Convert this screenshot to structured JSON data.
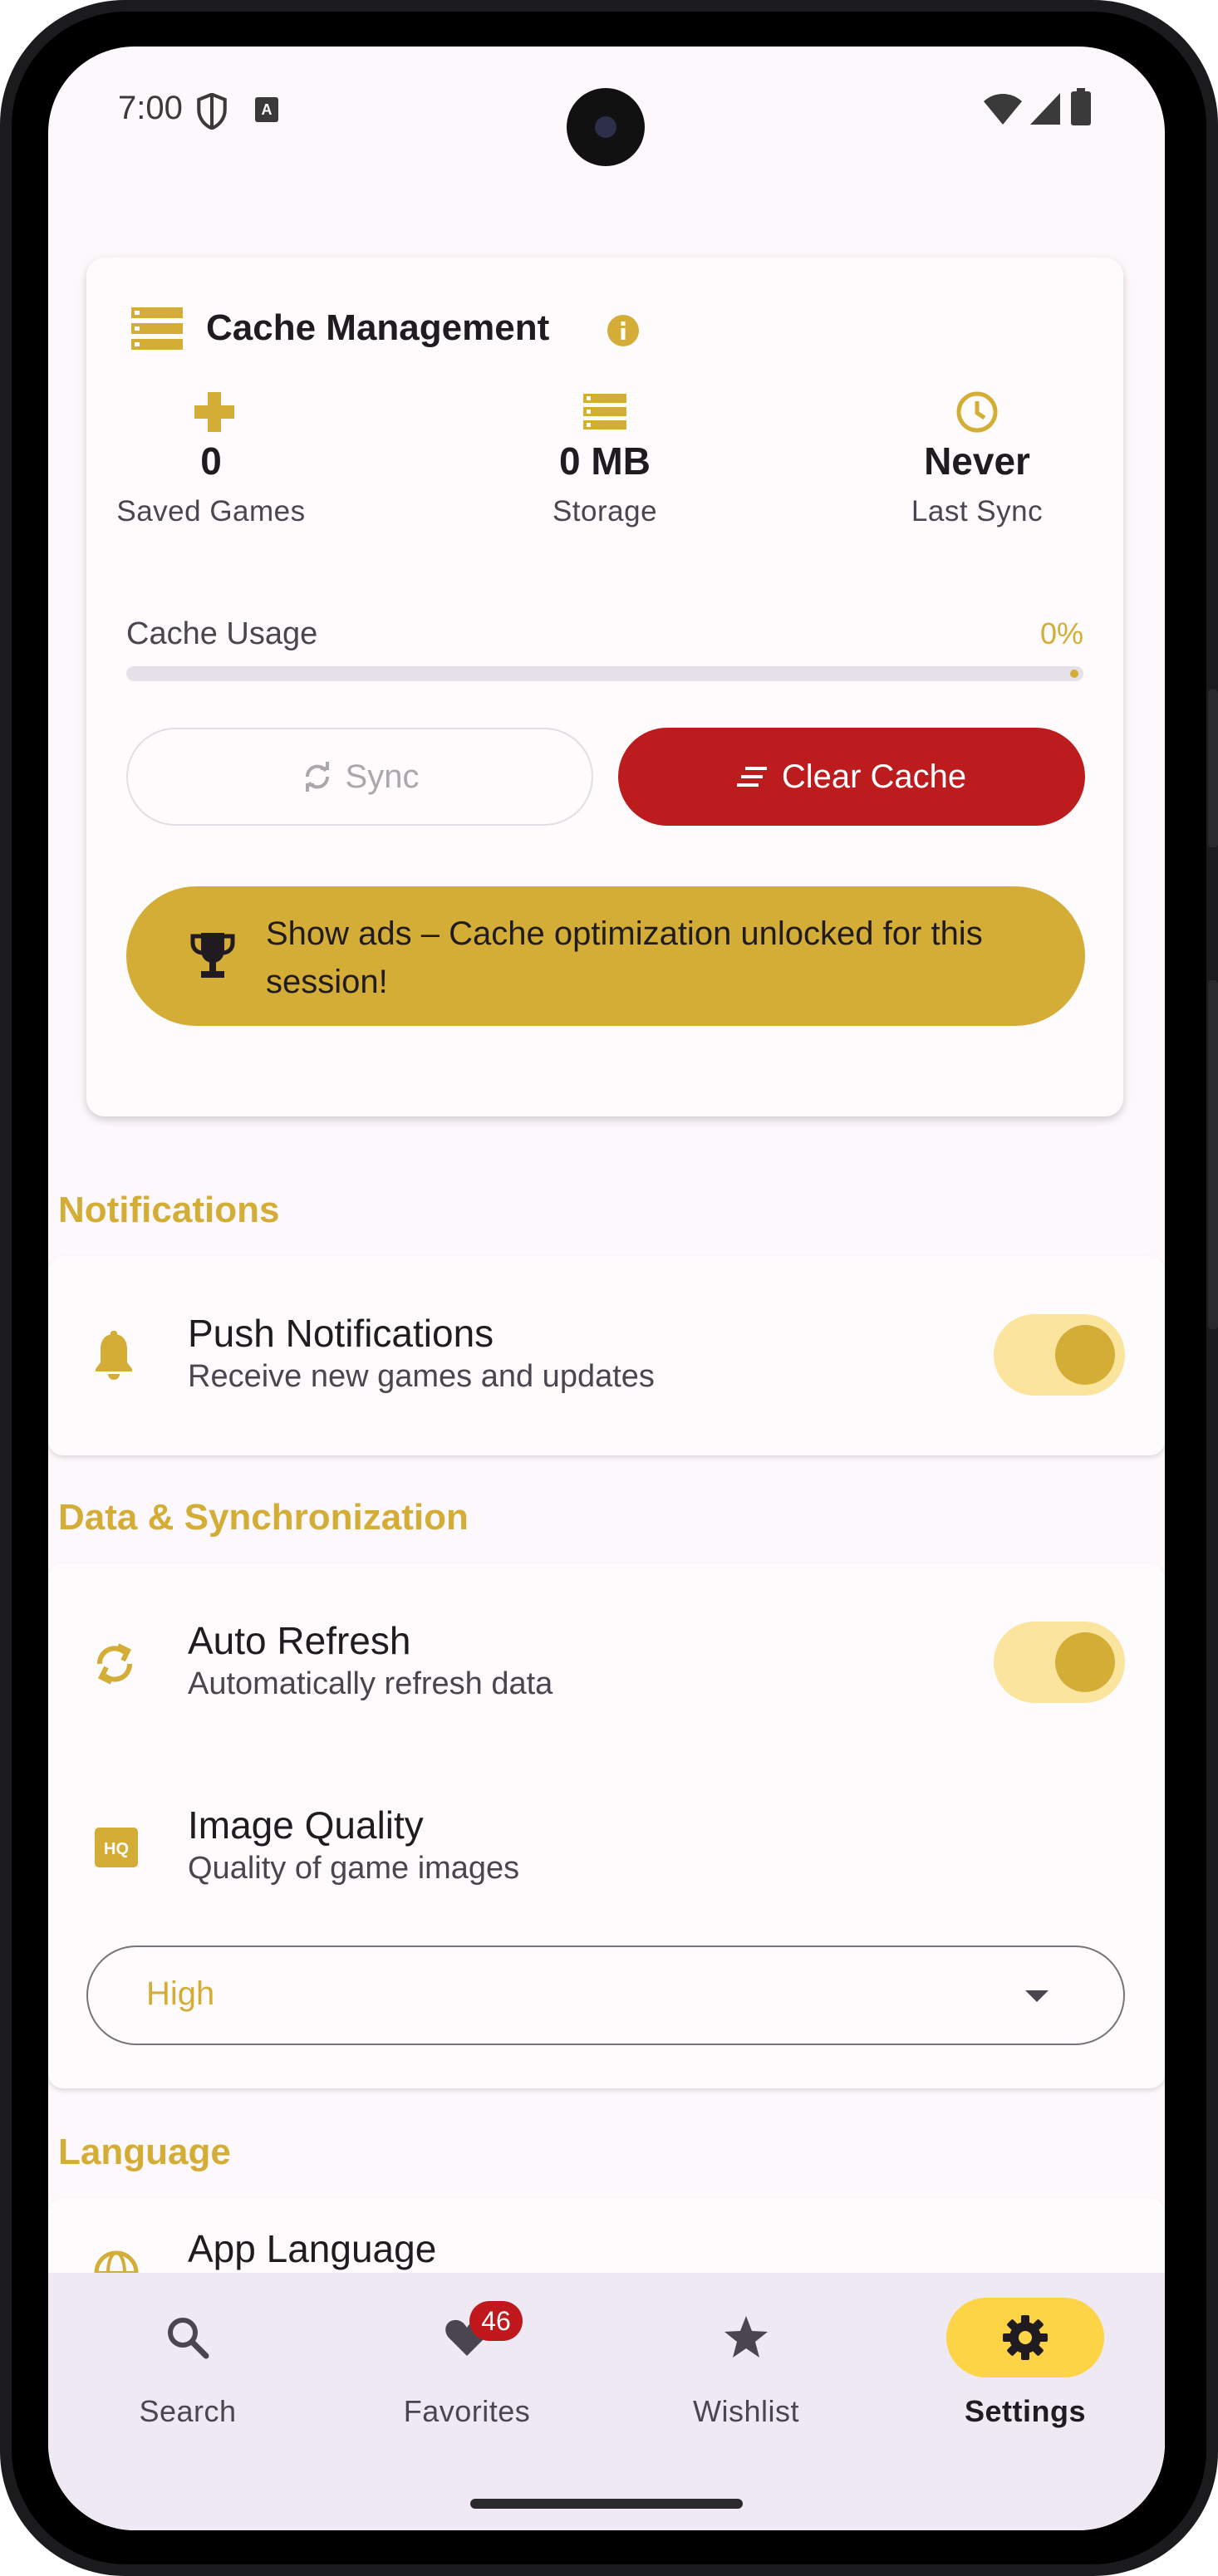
{
  "status_bar": {
    "time": "7:00"
  },
  "cache_card": {
    "title": "Cache Management",
    "stats": [
      {
        "value": "0",
        "label": "Saved Games",
        "icon": "gamepad-icon"
      },
      {
        "value": "0 MB",
        "label": "Storage",
        "icon": "storage-icon"
      },
      {
        "value": "Never",
        "label": "Last Sync",
        "icon": "clock-icon"
      }
    ],
    "usage_label": "Cache Usage",
    "usage_percent_text": "0%",
    "usage_fraction": 0,
    "sync_label": "Sync",
    "clear_label": "Clear Cache",
    "ad_text": "Show ads – Cache optimization unlocked for this session!"
  },
  "notifications": {
    "section_title": "Notifications",
    "push": {
      "title": "Push Notifications",
      "subtitle": "Receive new games and updates",
      "enabled": true
    }
  },
  "data_sync": {
    "section_title": "Data & Synchronization",
    "auto_refresh": {
      "title": "Auto Refresh",
      "subtitle": "Automatically refresh data",
      "enabled": true
    },
    "image_quality": {
      "title": "Image Quality",
      "subtitle": "Quality of game images",
      "selected": "High"
    }
  },
  "language": {
    "section_title": "Language",
    "app_language": {
      "title": "App Language"
    }
  },
  "bottom_nav": {
    "items": [
      {
        "label": "Search",
        "icon": "search-icon"
      },
      {
        "label": "Favorites",
        "icon": "heart-icon",
        "badge": "46"
      },
      {
        "label": "Wishlist",
        "icon": "star-icon"
      },
      {
        "label": "Settings",
        "icon": "gear-icon",
        "active": true
      }
    ]
  },
  "colors": {
    "accent": "#d4ad36",
    "danger": "#bd1c1f",
    "active_nav": "#fdd446",
    "toggle_track": "#fbe49e"
  }
}
